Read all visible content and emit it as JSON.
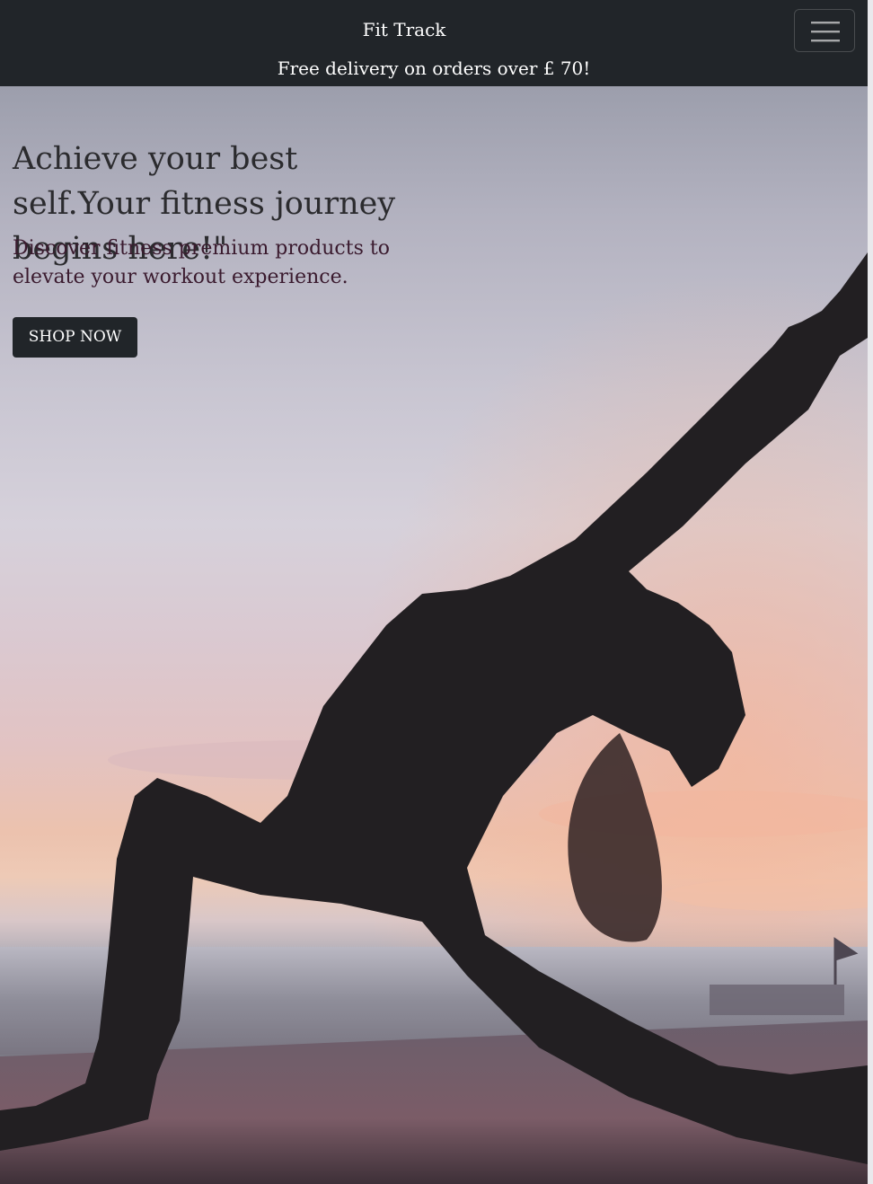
{
  "navbar": {
    "brand": "Fit Track",
    "toggler_icon": "hamburger-menu-icon"
  },
  "promo_banner": {
    "text": "Free delivery on orders over £ 70!"
  },
  "hero": {
    "headline": "Achieve your best self.Your fitness journey begins here!\"",
    "subheadline": "Discover fitness premium products to elevate your workout experience.",
    "cta_label": "SHOP NOW",
    "image_subject": "silhouette of a woman doing a yoga pose at sunset by the sea"
  },
  "colors": {
    "navbar_bg": "#212529",
    "navbar_text": "#ffffff",
    "button_bg": "#212529",
    "headline_text": "#2b2b2e",
    "subheadline_text": "#3a1a2e"
  }
}
